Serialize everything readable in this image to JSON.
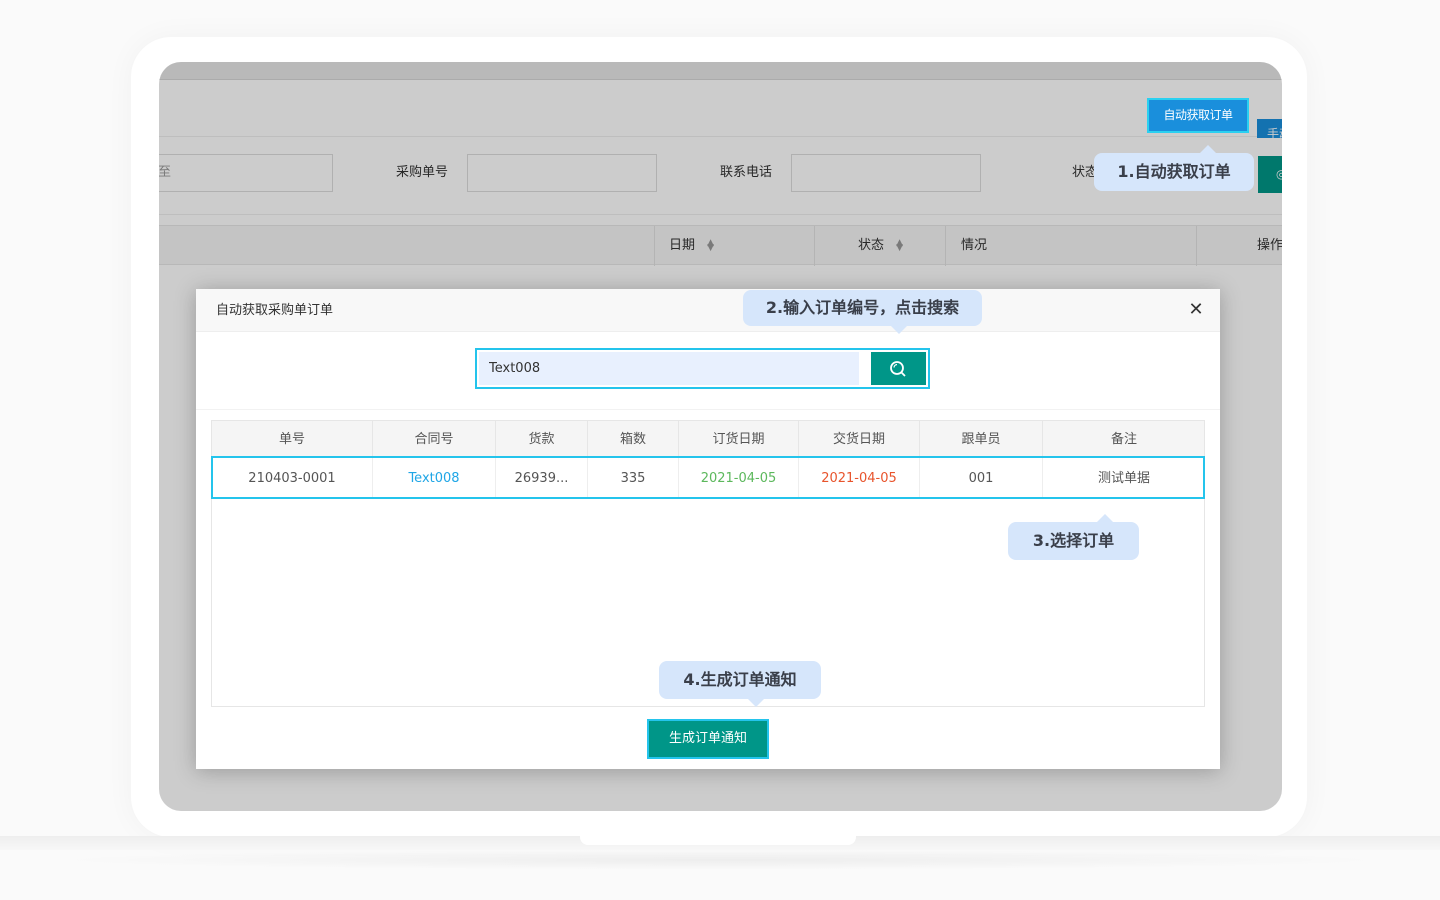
{
  "background_app": {
    "buttons": {
      "auto_fetch": "自动获取订单",
      "manual": "手动"
    },
    "filters": {
      "date_to_placeholder": "至",
      "purchase_no_label": "采购单号",
      "phone_label": "联系电话",
      "status_label": "状态"
    },
    "table_headers": {
      "date": "日期",
      "status": "状态",
      "situation": "情况",
      "action": "操作"
    }
  },
  "modal": {
    "title": "自动获取采购单订单",
    "search_value": "Text008",
    "columns": [
      "单号",
      "合同号",
      "货款",
      "箱数",
      "订货日期",
      "交货日期",
      "跟单员",
      "备注"
    ],
    "rows": [
      {
        "order_no": "210403-0001",
        "contract_no": "Text008",
        "payment": "26939...",
        "boxes": "335",
        "order_date": "2021-04-05",
        "delivery_date": "2021-04-05",
        "merchandiser": "001",
        "remark": "测试单据"
      }
    ],
    "generate_button": "生成订单通知"
  },
  "callouts": {
    "step1": "1.自动获取订单",
    "step2": "2.输入订单编号，点击搜索",
    "step3": "3.选择订单",
    "step4": "4.生成订单通知"
  },
  "colors": {
    "primary_teal": "#009688",
    "primary_blue": "#1a8fdc",
    "highlight_cyan": "#24c4ec",
    "callout_bg": "#d6e6fb",
    "contract_link": "#1fa6e6",
    "order_date_green": "#5cb85c",
    "delivery_date_red": "#e8542c"
  },
  "icons": {
    "close": "close-icon",
    "search": "search-icon",
    "sort": "sort-icon"
  }
}
